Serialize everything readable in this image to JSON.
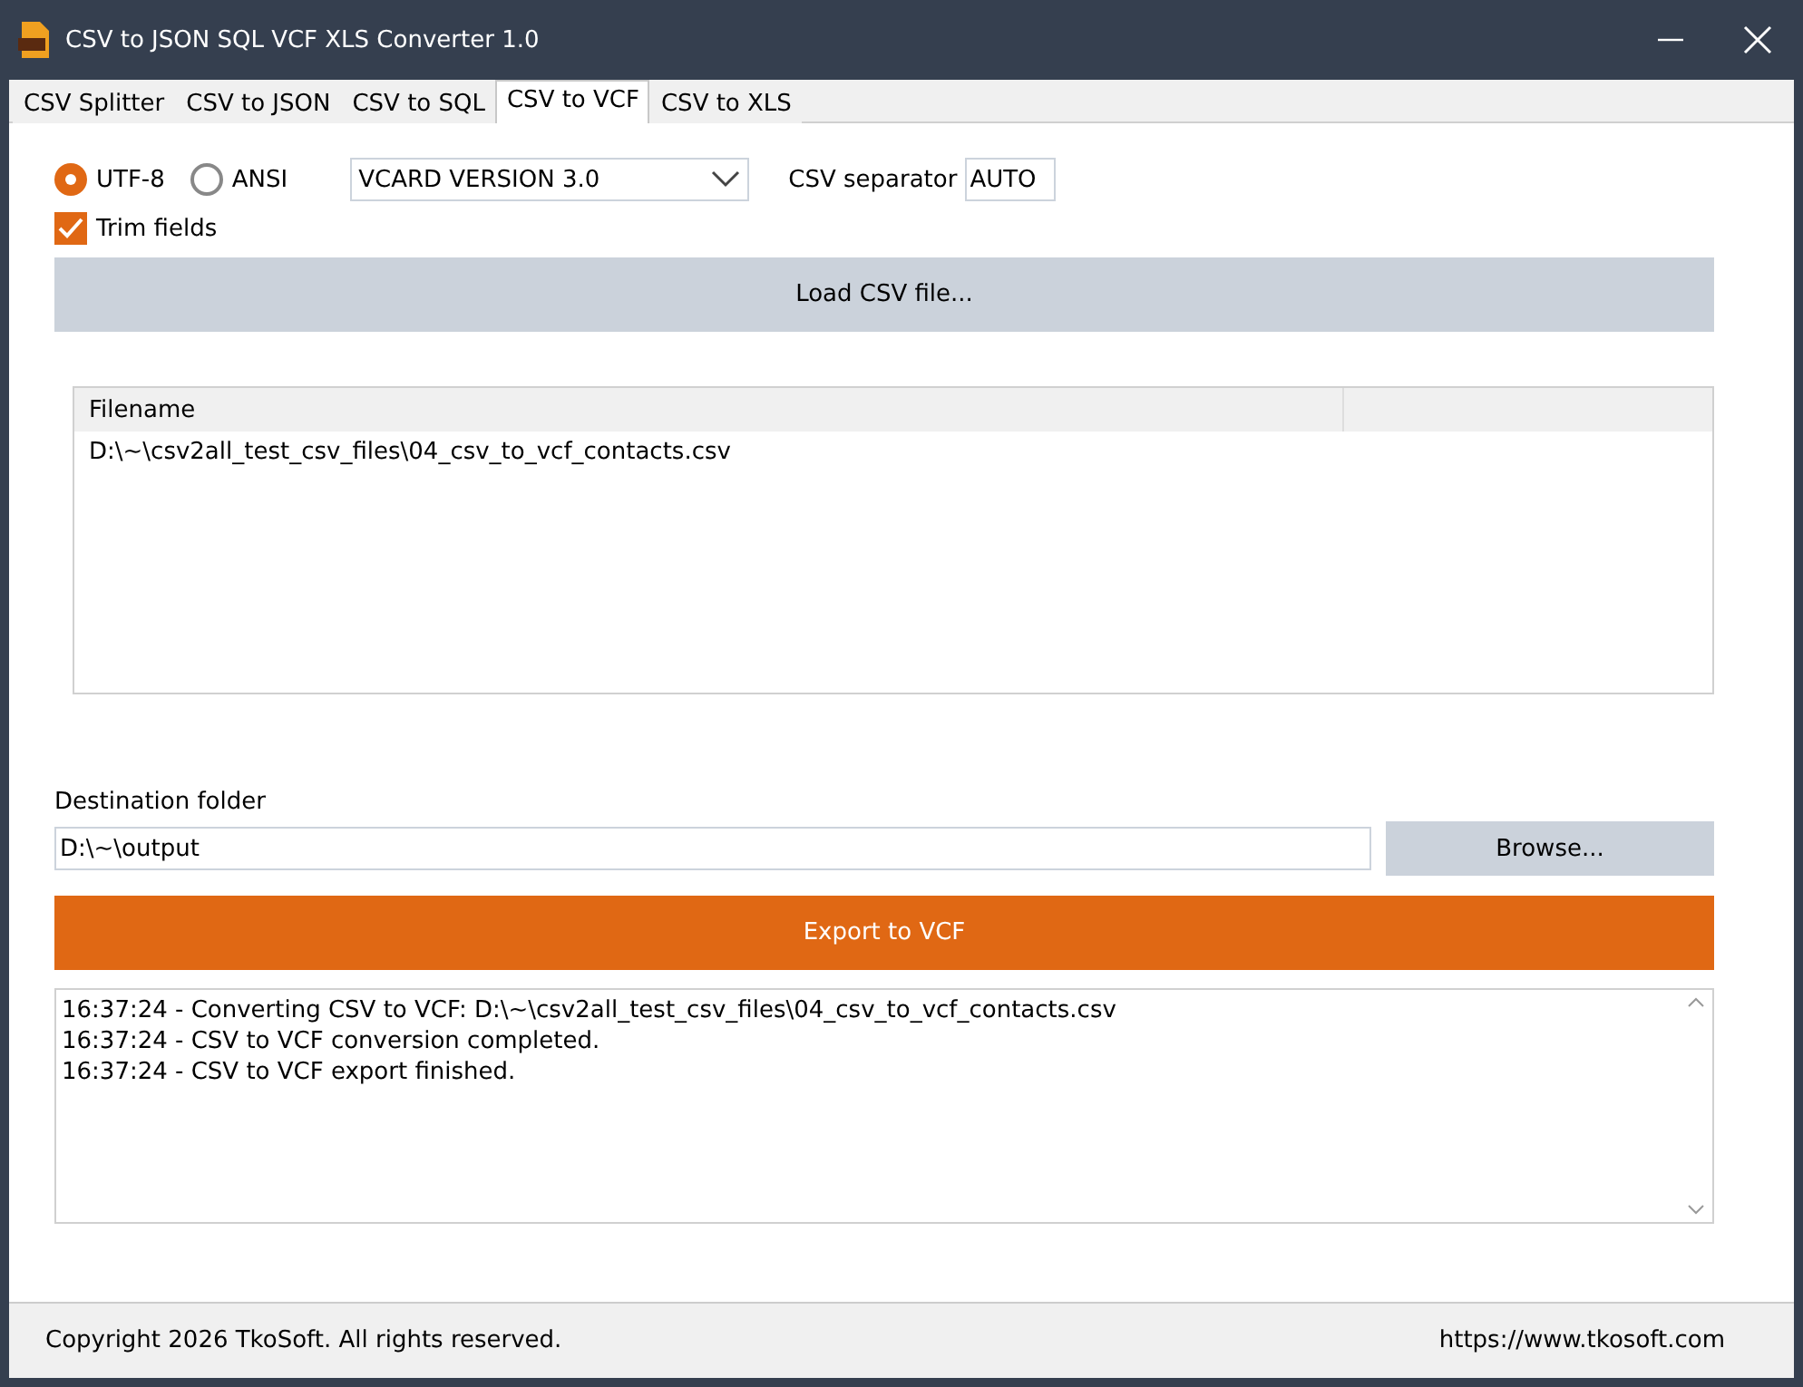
{
  "window": {
    "title": "CSV to JSON SQL VCF XLS Converter 1.0"
  },
  "tabs": [
    {
      "label": "CSV Splitter",
      "selected": false
    },
    {
      "label": "CSV to JSON",
      "selected": false
    },
    {
      "label": "CSV to SQL",
      "selected": false
    },
    {
      "label": "CSV to VCF",
      "selected": true
    },
    {
      "label": "CSV to XLS",
      "selected": false
    }
  ],
  "encodings": [
    {
      "label": "UTF-8",
      "selected": true
    },
    {
      "label": "ANSI",
      "selected": false
    }
  ],
  "version_select": {
    "value": "VCARD VERSION 3.0"
  },
  "separator": {
    "label": "CSV separator",
    "value": "AUTO"
  },
  "trim_fields": {
    "label": "Trim fields",
    "checked": true
  },
  "load_button": "Load CSV file...",
  "file_table": {
    "columns": [
      "Filename"
    ],
    "rows": [
      "D:\\~\\csv2all_test_csv_files\\04_csv_to_vcf_contacts.csv"
    ]
  },
  "destination": {
    "label": "Destination folder",
    "value": "D:\\~\\output",
    "browse": "Browse..."
  },
  "export_button": "Export to VCF",
  "log": [
    "16:37:24 - Converting CSV to VCF: D:\\~\\csv2all_test_csv_files\\04_csv_to_vcf_contacts.csv",
    "16:37:24 - CSV to VCF conversion completed.",
    "16:37:24 - CSV to VCF export finished."
  ],
  "status_bar": {
    "copyright": "Copyright 2026 TkoSoft. All rights reserved.",
    "url": "https://www.tkosoft.com"
  }
}
